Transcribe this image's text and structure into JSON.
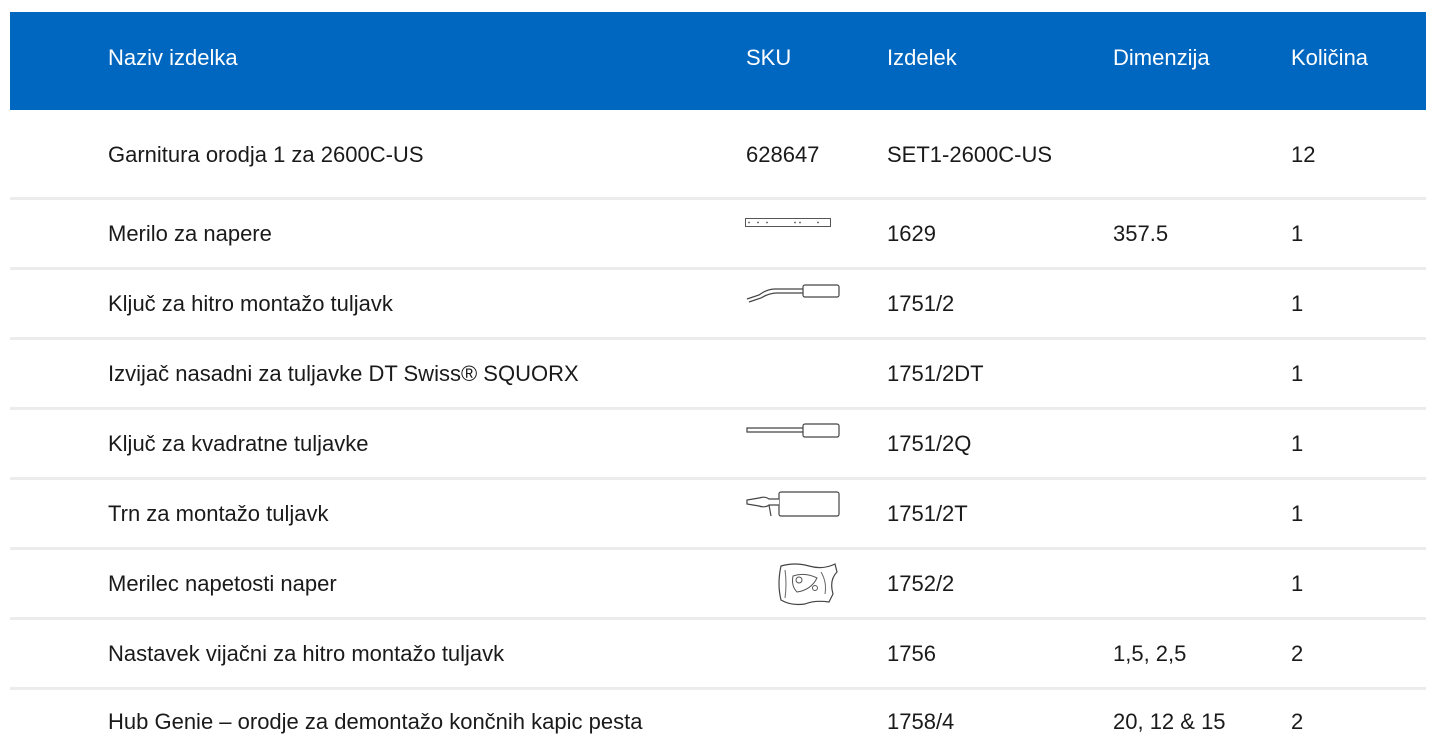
{
  "header": {
    "name": "Naziv izdelka",
    "sku": "SKU",
    "product": "Izdelek",
    "dimension": "Dimenzija",
    "quantity": "Količina"
  },
  "rows": [
    {
      "name": "Garnitura orodja 1 za 2600C-US",
      "sku": "628647",
      "product": "SET1-2600C-US",
      "dimension": "",
      "quantity": "12",
      "thumbnail": ""
    },
    {
      "name": "Merilo za napere",
      "sku": "",
      "product": "1629",
      "dimension": "357.5",
      "quantity": "1",
      "thumbnail": "spoke-ruler-icon"
    },
    {
      "name": "Ključ za hitro montažo tuljavk",
      "sku": "",
      "product": "1751/2",
      "dimension": "",
      "quantity": "1",
      "thumbnail": "bent-nipple-driver-icon"
    },
    {
      "name": "Izvijač nasadni za tuljavke DT Swiss® SQUORX",
      "sku": "",
      "product": "1751/2DT",
      "dimension": "",
      "quantity": "1",
      "thumbnail": ""
    },
    {
      "name": "Ključ za kvadratne tuljavke",
      "sku": "",
      "product": "1751/2Q",
      "dimension": "",
      "quantity": "1",
      "thumbnail": "screwdriver-icon"
    },
    {
      "name": "Trn za montažo tuljavk",
      "sku": "",
      "product": "1751/2T",
      "dimension": "",
      "quantity": "1",
      "thumbnail": "mandrel-tool-icon"
    },
    {
      "name": "Merilec napetosti naper",
      "sku": "",
      "product": "1752/2",
      "dimension": "",
      "quantity": "1",
      "thumbnail": "tension-meter-icon"
    },
    {
      "name": "Nastavek vijačni za hitro montažo tuljavk",
      "sku": "",
      "product": "1756",
      "dimension": "1,5, 2,5",
      "quantity": "2",
      "thumbnail": ""
    },
    {
      "name": "Hub Genie – orodje za demontažo končnih kapic pesta",
      "sku": "",
      "product": "1758/4",
      "dimension": "20, 12 & 15",
      "quantity": "2",
      "thumbnail": ""
    }
  ]
}
